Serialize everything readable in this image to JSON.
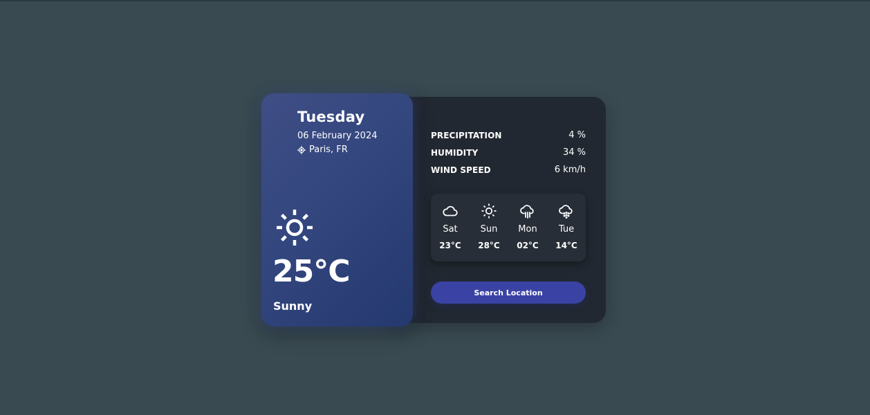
{
  "today": {
    "day": "Tuesday",
    "date": "06 February 2024",
    "location": "Paris, FR",
    "icon": "sun-icon",
    "temperature": "25°C",
    "condition": "Sunny"
  },
  "stats": [
    {
      "label": "PRECIPITATION",
      "value": "4 %"
    },
    {
      "label": "HUMIDITY",
      "value": "34 %"
    },
    {
      "label": "WIND SPEED",
      "value": "6 km/h"
    }
  ],
  "forecast": [
    {
      "day": "Sat",
      "temp": "23°C",
      "icon": "cloud-icon"
    },
    {
      "day": "Sun",
      "temp": "28°C",
      "icon": "sun-icon"
    },
    {
      "day": "Mon",
      "temp": "02°C",
      "icon": "rain-cloud-icon"
    },
    {
      "day": "Tue",
      "temp": "14°C",
      "icon": "snow-cloud-icon"
    }
  ],
  "search_button": "Search Location",
  "colors": {
    "background": "#394a51",
    "panel": "#222831",
    "accent": "#3a43a3",
    "card_gradient_start": "#3f4e85",
    "card_gradient_end": "#24396f"
  }
}
